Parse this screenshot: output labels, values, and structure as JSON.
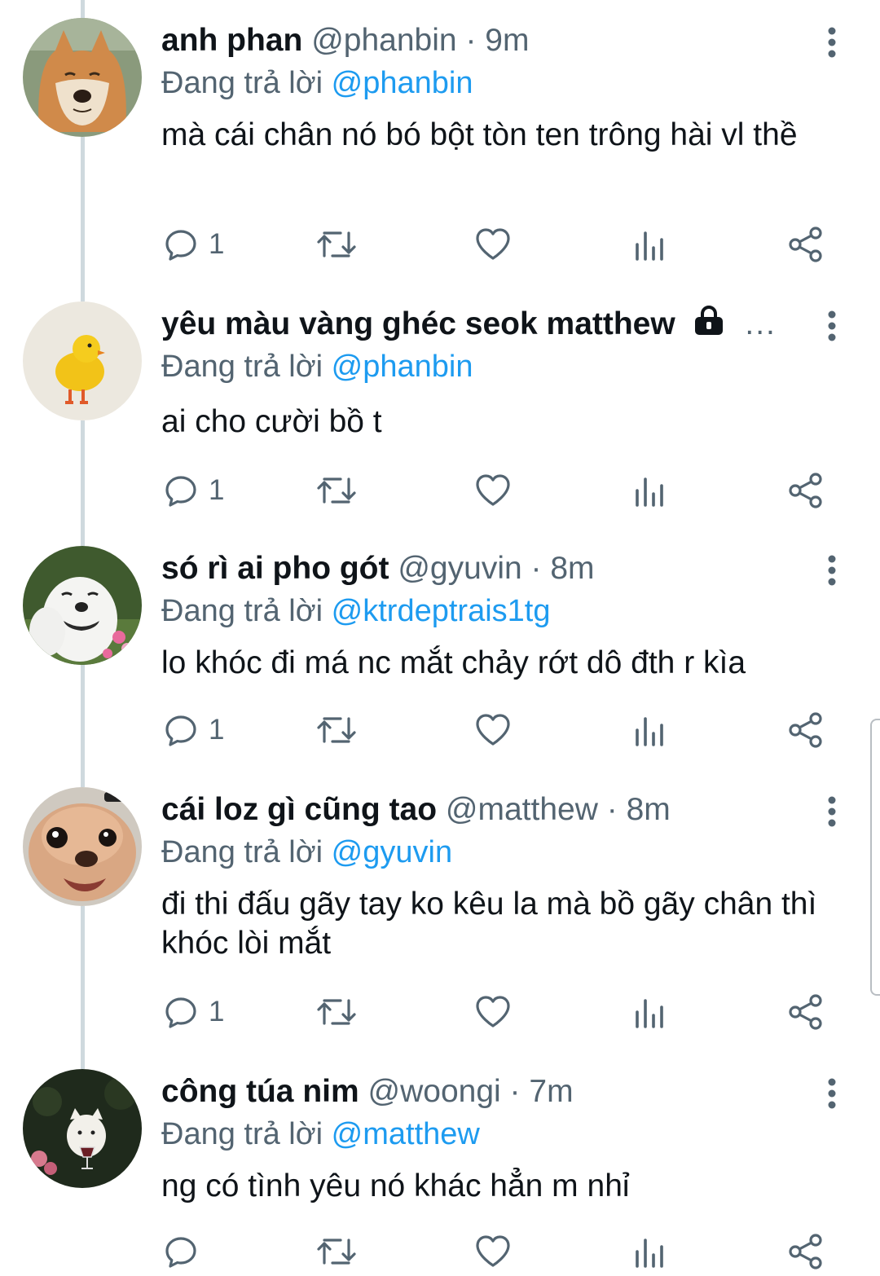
{
  "replying_prefix": "Đang trả lời",
  "tweets": [
    {
      "name": "anh phan",
      "handle": "@phanbin",
      "separator": "·",
      "time": "9m",
      "replying_to": "@phanbin",
      "text": "mà cái chân nó bó bột tòn ten trông hài vl thề",
      "reply_count": "1",
      "avatar_icon": "fox-avatar"
    },
    {
      "name": "yêu màu vàng ghéc seok matthew",
      "handle": "",
      "separator": "",
      "time": "",
      "truncation": "...",
      "protected": true,
      "replying_to": "@phanbin",
      "text": "ai cho cười bồ t",
      "reply_count": "1",
      "avatar_icon": "yellow-chick-avatar"
    },
    {
      "name": "só rì ai pho gót",
      "handle": "@gyuvin",
      "separator": "·",
      "time": "8m",
      "replying_to": "@ktrdeptrais1tg",
      "text": "lo khóc đi má nc mắt chảy rớt dô đth r kìa",
      "reply_count": "1",
      "avatar_icon": "smiling-dog-avatar"
    },
    {
      "name": "cái loz gì cũng tao",
      "handle": "@matthew",
      "separator": "·",
      "time": "8m",
      "replying_to": "@gyuvin",
      "text": "đi thi đấu gãy tay ko kêu la mà bồ gãy chân thì khóc lòi mắt",
      "reply_count": "1",
      "avatar_icon": "chihuahua-avatar"
    },
    {
      "name": "công túa nim",
      "handle": "@woongi",
      "separator": "·",
      "time": "7m",
      "replying_to": "@matthew",
      "text": "ng có tình yêu nó khác hẳn m nhỉ",
      "reply_count": "",
      "avatar_icon": "dog-wineglass-avatar"
    }
  ],
  "colors": {
    "text": "#0f1419",
    "secondary": "#536471",
    "link": "#1d9bf0",
    "thread_line": "#cfd9de"
  }
}
